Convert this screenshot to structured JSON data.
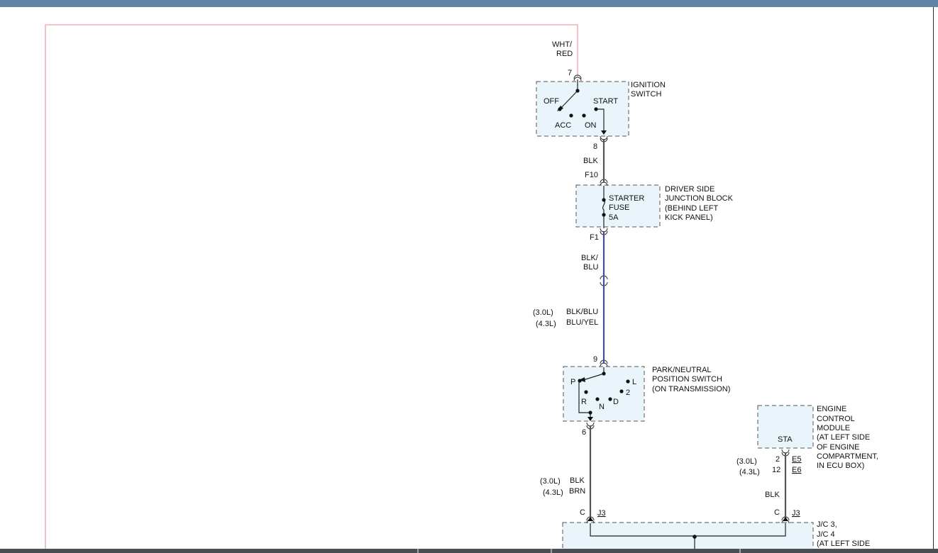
{
  "ignition_switch": {
    "input_wire": {
      "color": "WHT/",
      "color2": "RED",
      "pin": "7"
    },
    "name": [
      "IGNITION",
      "SWITCH"
    ],
    "positions": [
      "OFF",
      "START",
      "ACC",
      "ON"
    ],
    "output_pin": "8"
  },
  "wire_blk_1": "BLK",
  "junction_block": {
    "pin_in": "F10",
    "pin_out": "F1",
    "fuse": [
      "STARTER",
      "FUSE",
      "5A"
    ],
    "name": [
      "DRIVER SIDE",
      "JUNCTION BLOCK",
      "(BEHIND LEFT",
      "KICK PANEL)"
    ]
  },
  "wire_blk_blu": [
    "BLK/",
    "BLU"
  ],
  "engine_variants": {
    "v30": "(3.0L)",
    "v43": "(4.3L)",
    "wire_30": "BLK/BLU",
    "wire_43": "BLU/YEL"
  },
  "park_neutral_switch": {
    "pin_in": "9",
    "pin_out": "6",
    "positions": [
      "P",
      "L",
      "2",
      "R",
      "N",
      "D"
    ],
    "name": [
      "PARK/NEUTRAL",
      "POSITION SWITCH",
      "(ON TRANSMISSION)"
    ]
  },
  "pnp_output_wire": {
    "v30": "(3.0L)",
    "v43": "(4.3L)",
    "c30": "BLK",
    "c43": "BRN"
  },
  "ecm": {
    "terminal": "STA",
    "name": [
      "ENGINE",
      "CONTROL",
      "MODULE",
      "(AT LEFT SIDE",
      "OF ENGINE",
      "COMPARTMENT,",
      "IN ECU BOX)"
    ],
    "v30": "(3.0L)",
    "v43": "(4.3L)",
    "pin_30": "2",
    "pin_43": "12",
    "conn_30": "E5",
    "conn_43": "E6",
    "wire": "BLK"
  },
  "jc": {
    "pin_left": "C",
    "conn_left": "J3",
    "pin_right": "C",
    "conn_right": "J3",
    "name": [
      "J/C 3,",
      "J/C 4",
      "(AT LEFT SIDE"
    ]
  },
  "colors": {
    "wire_pink": "#f2a0aa",
    "wire_dark": "#555555",
    "wire_blue": "#4a4aa0",
    "box_fill": "#eaf4fb"
  }
}
